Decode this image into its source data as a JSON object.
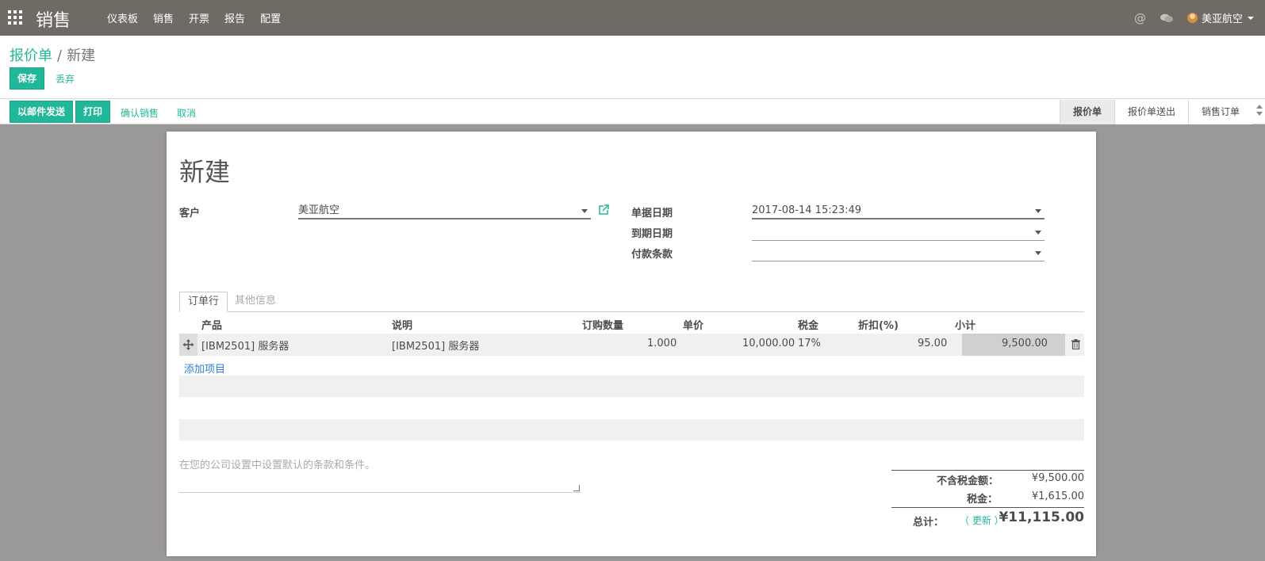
{
  "topbar": {
    "brand": "销售",
    "menu": [
      "仪表板",
      "销售",
      "开票",
      "报告",
      "配置"
    ],
    "user": "美亚航空",
    "at_symbol": "@"
  },
  "breadcrumb": {
    "parent": "报价单",
    "separator": "/",
    "current": "新建"
  },
  "actions": {
    "save": "保存",
    "discard": "丢弃"
  },
  "statusbar": {
    "send_email": "以邮件发送",
    "print": "打印",
    "confirm_sale": "确认销售",
    "cancel": "取消",
    "stages": [
      "报价单",
      "报价单送出",
      "销售订单"
    ],
    "active_stage": "报价单"
  },
  "form": {
    "title": "新建",
    "customer_label": "客户",
    "customer_value": "美亚航空",
    "date_order_label": "单据日期",
    "date_order_value": "2017-08-14 15:23:49",
    "validity_label": "到期日期",
    "validity_value": "",
    "payment_terms_label": "付款条款",
    "payment_terms_value": ""
  },
  "tabs": [
    "订单行",
    "其他信息"
  ],
  "order_lines": {
    "columns": [
      "产品",
      "说明",
      "订购数量",
      "单价",
      "税金",
      "折扣(%)",
      "小计"
    ],
    "rows": [
      {
        "product": "[IBM2501] 服务器",
        "description": "[IBM2501] 服务器",
        "quantity": "1.000",
        "unit_price": "10,000.00",
        "taxes": "17%",
        "discount": "95.00",
        "subtotal": "9,500.00"
      }
    ],
    "add_item": "添加项目"
  },
  "notes_placeholder": "在您的公司设置中设置默认的条款和条件。",
  "totals": {
    "untaxed_label": "不含税金额：",
    "untaxed_value": "¥9,500.00",
    "tax_label": "税金：",
    "tax_value": "¥1,615.00",
    "total_label": "总计：",
    "update_label": "（ 更新 ）",
    "total_value": "¥11,115.00"
  },
  "colors": {
    "accent": "#21b799",
    "topbar": "#6f6a63",
    "link_blue": "#2e7fd5"
  }
}
